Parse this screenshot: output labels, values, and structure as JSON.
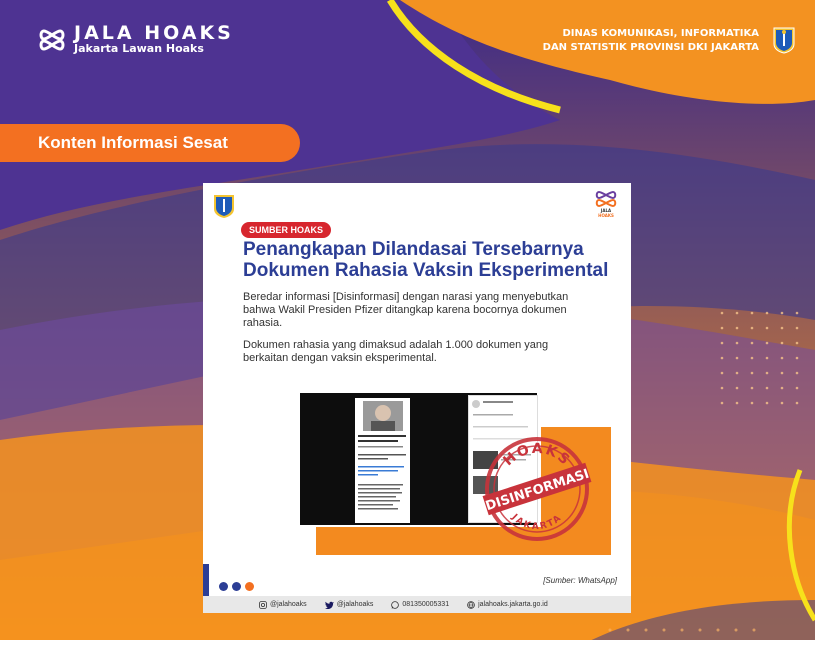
{
  "header": {
    "logo_title": "JALA HOAKS",
    "logo_subtitle": "Jakarta Lawan Hoaks",
    "dept_line1": "DINAS KOMUNIKASI, INFORMATIKA",
    "dept_line2": "DAN STATISTIK PROVINSI DKI JAKARTA"
  },
  "category_label": "Konten Informasi Sesat",
  "card": {
    "badge": "SUMBER HOAKS",
    "headline_line1": "Penangkapan Dilandasai Tersebarnya",
    "headline_line2": "Dokumen Rahasia Vaksin Eksperimental",
    "paragraph1": "Beredar informasi [Disinformasi] dengan narasi yang menyebutkan bahwa Wakil Presiden Pfizer ditangkap karena bocornya dokumen rahasia.",
    "paragraph2": "Dokumen rahasia yang dimaksud adalah 1.000 dokumen yang berkaitan dengan vaksin eksperimental.",
    "stamp_top": "HOAKS",
    "stamp_middle": "DISINFORMASI",
    "stamp_bottom": "JAKARTA",
    "logo_text": "JALA HOAKS",
    "source": "[Sumber: WhatsApp]",
    "footer": {
      "instagram": "@jalahoaks",
      "twitter": "@jalahoaks",
      "whatsapp": "081350005331",
      "website": "jalahoaks.jakarta.go.id"
    }
  },
  "colors": {
    "orange": "#F37021",
    "navy": "#2C3E95",
    "purple": "#4A2E8A",
    "red": "#D7262E"
  }
}
